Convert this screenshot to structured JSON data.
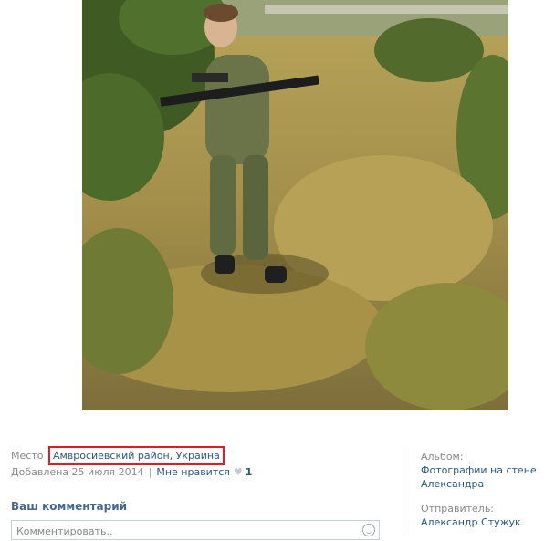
{
  "photo": {
    "description_icon": "photo-soldier-in-field"
  },
  "info": {
    "place_label": "Место",
    "place_value": "Амвросиевский район, Украина",
    "added_text": "Добавлена 25 июля 2014",
    "like_label": "Мне нравится",
    "like_icon": "heart-icon",
    "like_count": "1"
  },
  "sidebar": {
    "album_label": "Альбом:",
    "album_value": "Фотографии на стене Александра",
    "sender_label": "Отправитель:",
    "sender_value": "Александр Стужук"
  },
  "comment": {
    "heading": "Ваш комментарий",
    "placeholder": "Комментировать..",
    "emoji_icon": "smile-icon"
  },
  "colors": {
    "link": "#2b587a",
    "highlight": "#e31b23",
    "muted": "#8a8a8a"
  }
}
